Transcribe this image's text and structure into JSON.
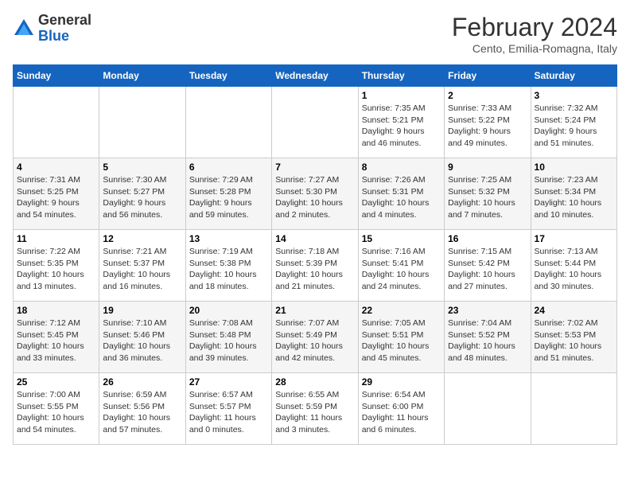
{
  "header": {
    "logo_general": "General",
    "logo_blue": "Blue",
    "month_title": "February 2024",
    "location": "Cento, Emilia-Romagna, Italy"
  },
  "days_of_week": [
    "Sunday",
    "Monday",
    "Tuesday",
    "Wednesday",
    "Thursday",
    "Friday",
    "Saturday"
  ],
  "weeks": [
    [
      {
        "day": "",
        "info": ""
      },
      {
        "day": "",
        "info": ""
      },
      {
        "day": "",
        "info": ""
      },
      {
        "day": "",
        "info": ""
      },
      {
        "day": "1",
        "info": "Sunrise: 7:35 AM\nSunset: 5:21 PM\nDaylight: 9 hours\nand 46 minutes."
      },
      {
        "day": "2",
        "info": "Sunrise: 7:33 AM\nSunset: 5:22 PM\nDaylight: 9 hours\nand 49 minutes."
      },
      {
        "day": "3",
        "info": "Sunrise: 7:32 AM\nSunset: 5:24 PM\nDaylight: 9 hours\nand 51 minutes."
      }
    ],
    [
      {
        "day": "4",
        "info": "Sunrise: 7:31 AM\nSunset: 5:25 PM\nDaylight: 9 hours\nand 54 minutes."
      },
      {
        "day": "5",
        "info": "Sunrise: 7:30 AM\nSunset: 5:27 PM\nDaylight: 9 hours\nand 56 minutes."
      },
      {
        "day": "6",
        "info": "Sunrise: 7:29 AM\nSunset: 5:28 PM\nDaylight: 9 hours\nand 59 minutes."
      },
      {
        "day": "7",
        "info": "Sunrise: 7:27 AM\nSunset: 5:30 PM\nDaylight: 10 hours\nand 2 minutes."
      },
      {
        "day": "8",
        "info": "Sunrise: 7:26 AM\nSunset: 5:31 PM\nDaylight: 10 hours\nand 4 minutes."
      },
      {
        "day": "9",
        "info": "Sunrise: 7:25 AM\nSunset: 5:32 PM\nDaylight: 10 hours\nand 7 minutes."
      },
      {
        "day": "10",
        "info": "Sunrise: 7:23 AM\nSunset: 5:34 PM\nDaylight: 10 hours\nand 10 minutes."
      }
    ],
    [
      {
        "day": "11",
        "info": "Sunrise: 7:22 AM\nSunset: 5:35 PM\nDaylight: 10 hours\nand 13 minutes."
      },
      {
        "day": "12",
        "info": "Sunrise: 7:21 AM\nSunset: 5:37 PM\nDaylight: 10 hours\nand 16 minutes."
      },
      {
        "day": "13",
        "info": "Sunrise: 7:19 AM\nSunset: 5:38 PM\nDaylight: 10 hours\nand 18 minutes."
      },
      {
        "day": "14",
        "info": "Sunrise: 7:18 AM\nSunset: 5:39 PM\nDaylight: 10 hours\nand 21 minutes."
      },
      {
        "day": "15",
        "info": "Sunrise: 7:16 AM\nSunset: 5:41 PM\nDaylight: 10 hours\nand 24 minutes."
      },
      {
        "day": "16",
        "info": "Sunrise: 7:15 AM\nSunset: 5:42 PM\nDaylight: 10 hours\nand 27 minutes."
      },
      {
        "day": "17",
        "info": "Sunrise: 7:13 AM\nSunset: 5:44 PM\nDaylight: 10 hours\nand 30 minutes."
      }
    ],
    [
      {
        "day": "18",
        "info": "Sunrise: 7:12 AM\nSunset: 5:45 PM\nDaylight: 10 hours\nand 33 minutes."
      },
      {
        "day": "19",
        "info": "Sunrise: 7:10 AM\nSunset: 5:46 PM\nDaylight: 10 hours\nand 36 minutes."
      },
      {
        "day": "20",
        "info": "Sunrise: 7:08 AM\nSunset: 5:48 PM\nDaylight: 10 hours\nand 39 minutes."
      },
      {
        "day": "21",
        "info": "Sunrise: 7:07 AM\nSunset: 5:49 PM\nDaylight: 10 hours\nand 42 minutes."
      },
      {
        "day": "22",
        "info": "Sunrise: 7:05 AM\nSunset: 5:51 PM\nDaylight: 10 hours\nand 45 minutes."
      },
      {
        "day": "23",
        "info": "Sunrise: 7:04 AM\nSunset: 5:52 PM\nDaylight: 10 hours\nand 48 minutes."
      },
      {
        "day": "24",
        "info": "Sunrise: 7:02 AM\nSunset: 5:53 PM\nDaylight: 10 hours\nand 51 minutes."
      }
    ],
    [
      {
        "day": "25",
        "info": "Sunrise: 7:00 AM\nSunset: 5:55 PM\nDaylight: 10 hours\nand 54 minutes."
      },
      {
        "day": "26",
        "info": "Sunrise: 6:59 AM\nSunset: 5:56 PM\nDaylight: 10 hours\nand 57 minutes."
      },
      {
        "day": "27",
        "info": "Sunrise: 6:57 AM\nSunset: 5:57 PM\nDaylight: 11 hours\nand 0 minutes."
      },
      {
        "day": "28",
        "info": "Sunrise: 6:55 AM\nSunset: 5:59 PM\nDaylight: 11 hours\nand 3 minutes."
      },
      {
        "day": "29",
        "info": "Sunrise: 6:54 AM\nSunset: 6:00 PM\nDaylight: 11 hours\nand 6 minutes."
      },
      {
        "day": "",
        "info": ""
      },
      {
        "day": "",
        "info": ""
      }
    ]
  ]
}
